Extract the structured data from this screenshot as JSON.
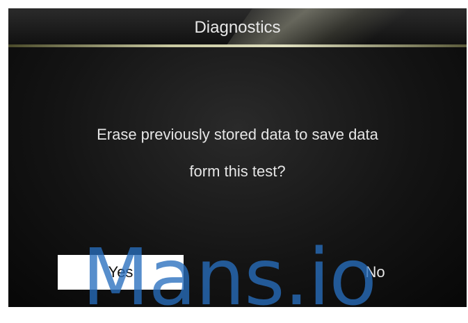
{
  "header": {
    "title": "Diagnostics"
  },
  "dialog": {
    "message_line_1": "Erase previously stored data to save data",
    "message_line_2": "form this test?"
  },
  "buttons": {
    "yes_label": "Yes",
    "no_label": "No",
    "selected": "Yes"
  },
  "watermark": {
    "text": "Mans.io"
  },
  "colors": {
    "screen_background": "#111111",
    "text": "#e6e6e6",
    "selected_button": "#ffffff",
    "watermark": "#286ebe"
  }
}
